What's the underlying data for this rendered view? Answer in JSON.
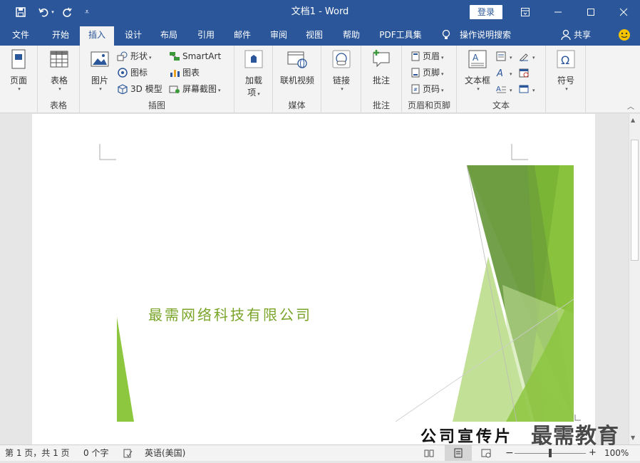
{
  "window": {
    "title": "文档1  -  Word",
    "login": "登录"
  },
  "tabs": [
    "文件",
    "开始",
    "插入",
    "设计",
    "布局",
    "引用",
    "邮件",
    "审阅",
    "视图",
    "帮助",
    "PDF工具集",
    "操作说明搜索",
    "共享"
  ],
  "ribbon": {
    "page": {
      "label": "页面",
      "group": ""
    },
    "table": {
      "label": "表格",
      "group": "表格"
    },
    "illustrations": {
      "group": "插图",
      "picture": "图片",
      "shapes": "形状",
      "icons": "图标",
      "model3d": "3D 模型",
      "smartart": "SmartArt",
      "chart": "图表",
      "screenshot": "屏幕截图"
    },
    "addins": {
      "label1": "加载",
      "label2": "项"
    },
    "media": {
      "label": "联机视频",
      "group": "媒体"
    },
    "links": {
      "label": "链接"
    },
    "comments": {
      "label": "批注",
      "group": "批注"
    },
    "headerfooter": {
      "group": "页眉和页脚",
      "header": "页眉",
      "footer": "页脚",
      "pagenum": "页码"
    },
    "text": {
      "group": "文本",
      "textbox": "文本框"
    },
    "symbols": {
      "label": "符号"
    }
  },
  "document": {
    "company": "最需网络科技有限公司",
    "promo": "公司宣传片"
  },
  "status": {
    "page": "第 1 页，共 1 页",
    "words": "0 个字",
    "lang": "英语(美国)",
    "zoom": "100%"
  },
  "watermark": "最需教育",
  "colors": {
    "accent": "#2b579a",
    "green_dark": "#5a8f2a",
    "green_light": "#8dc63f"
  }
}
